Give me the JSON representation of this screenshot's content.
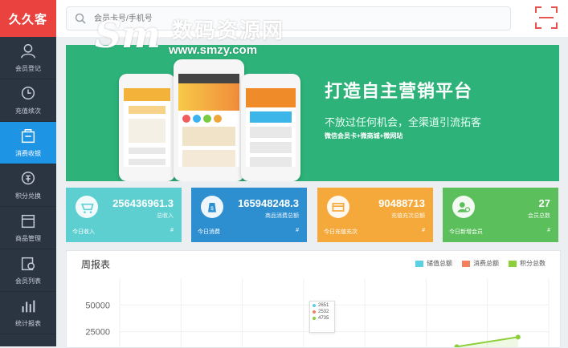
{
  "app": {
    "logo_text": "久久客"
  },
  "sidebar": {
    "items": [
      {
        "label": "会员登记",
        "icon": "user-add-icon"
      },
      {
        "label": "充值续次",
        "icon": "recharge-icon"
      },
      {
        "label": "消费收银",
        "icon": "cashier-icon"
      },
      {
        "label": "积分兑换",
        "icon": "points-exchange-icon"
      },
      {
        "label": "商品管理",
        "icon": "goods-icon"
      },
      {
        "label": "会员列表",
        "icon": "member-list-icon"
      },
      {
        "label": "统计报表",
        "icon": "bar-chart-icon"
      }
    ],
    "active_index": 2
  },
  "search": {
    "placeholder": "会员卡号/手机号"
  },
  "watermark": {
    "logo": "Sm",
    "name": "数码资源网",
    "url": "www.smzy.com"
  },
  "banner": {
    "title": "打造自主营销平台",
    "subtitle": "不放过任何机会，全渠道引流拓客",
    "tags": "微信会员卡+微商城+微网站"
  },
  "cards": [
    {
      "value": "256436961.3",
      "label": "总收入",
      "footer_left": "今日收入",
      "footer_right": "#",
      "color": "#5ecfd0",
      "icon": "cart-icon"
    },
    {
      "value": "165948248.3",
      "label": "商品消费总额",
      "footer_left": "今日消费",
      "footer_right": "#",
      "color": "#2e8fd0",
      "icon": "money-bag-icon"
    },
    {
      "value": "90488713",
      "label": "充值充次总额",
      "footer_left": "今日充值充次",
      "footer_right": "#",
      "color": "#f5a93b",
      "icon": "card-icon"
    },
    {
      "value": "27",
      "label": "会员总数",
      "footer_left": "今日新增会员",
      "footer_right": "#",
      "color": "#5bbf5b",
      "icon": "member-icon"
    }
  ],
  "report": {
    "title": "周报表",
    "legend": [
      {
        "name": "储值总额",
        "color": "#5ad0e4"
      },
      {
        "name": "消费总额",
        "color": "#f3805b"
      },
      {
        "name": "积分总数",
        "color": "#8ccf3a"
      }
    ],
    "tooltip": [
      {
        "value": "2651",
        "color": "#5ad0e4"
      },
      {
        "value": "2532",
        "color": "#f3805b"
      },
      {
        "value": "4735",
        "color": "#8ccf3a"
      }
    ]
  },
  "chart_data": {
    "type": "line",
    "title": "周报表",
    "y_ticks": [
      50000,
      25000
    ],
    "ylim": [
      0,
      75000
    ],
    "series": [
      {
        "name": "储值总额",
        "values": []
      },
      {
        "name": "消费总额",
        "values": []
      },
      {
        "name": "积分总数",
        "values": [
          null,
          null,
          null,
          null,
          null,
          11000,
          20000
        ]
      }
    ],
    "grid": true,
    "legend": "top-right"
  }
}
